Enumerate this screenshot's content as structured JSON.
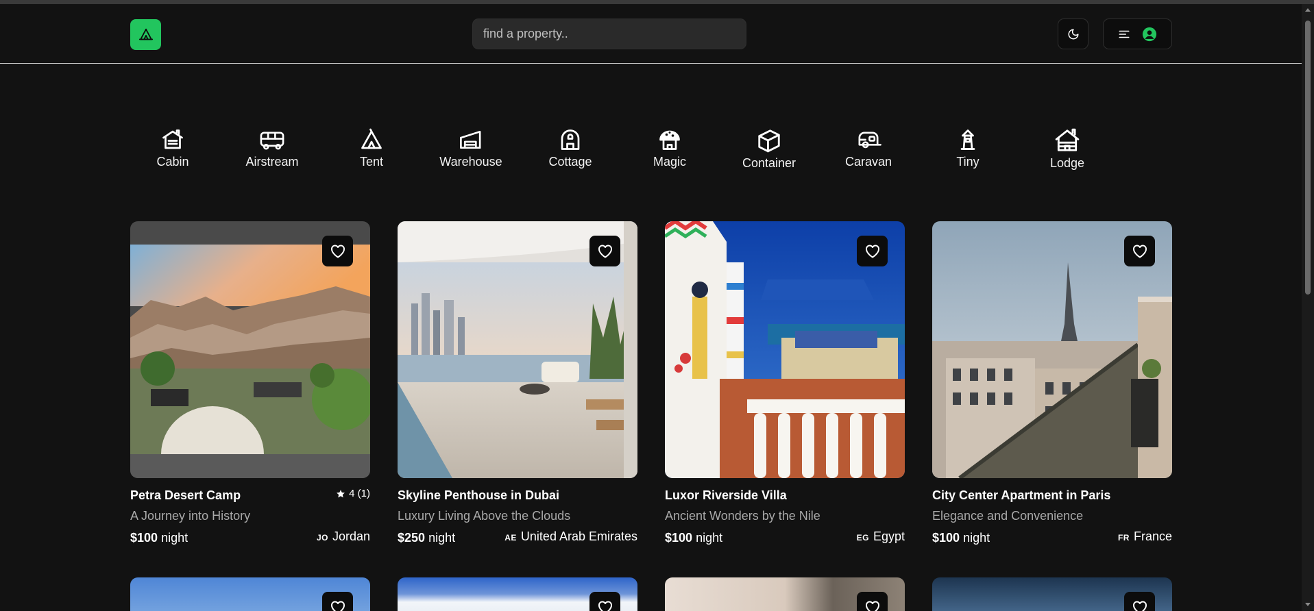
{
  "search": {
    "placeholder": "find a property.."
  },
  "header": {
    "logo_icon": "tent-icon",
    "theme_icon": "moon-icon",
    "menu_icon": "menu-icon",
    "user_icon": "user-avatar-icon",
    "accent": "#22c55e"
  },
  "categories": [
    {
      "label": "Cabin",
      "icon": "cabin-icon"
    },
    {
      "label": "Airstream",
      "icon": "bus-icon"
    },
    {
      "label": "Tent",
      "icon": "tent-icon"
    },
    {
      "label": "Warehouse",
      "icon": "warehouse-icon"
    },
    {
      "label": "Cottage",
      "icon": "cottage-icon"
    },
    {
      "label": "Magic",
      "icon": "mushroom-house-icon"
    },
    {
      "label": "Container",
      "icon": "container-icon"
    },
    {
      "label": "Caravan",
      "icon": "caravan-icon"
    },
    {
      "label": "Tiny",
      "icon": "tiny-house-icon"
    },
    {
      "label": "Lodge",
      "icon": "lodge-icon"
    }
  ],
  "properties": [
    {
      "title": "Petra Desert Camp",
      "rating": "4 (1)",
      "tagline": "A Journey into History",
      "price": "$100",
      "unit": "night",
      "country_code": "JO",
      "country": "Jordan"
    },
    {
      "title": "Skyline Penthouse in Dubai",
      "rating": "",
      "tagline": "Luxury Living Above the Clouds",
      "price": "$250",
      "unit": "night",
      "country_code": "AE",
      "country": "United Arab Emirates"
    },
    {
      "title": "Luxor Riverside Villa",
      "rating": "",
      "tagline": "Ancient Wonders by the Nile",
      "price": "$100",
      "unit": "night",
      "country_code": "EG",
      "country": "Egypt"
    },
    {
      "title": "City Center Apartment in Paris",
      "rating": "",
      "tagline": "Elegance and Convenience",
      "price": "$100",
      "unit": "night",
      "country_code": "FR",
      "country": "France"
    }
  ]
}
